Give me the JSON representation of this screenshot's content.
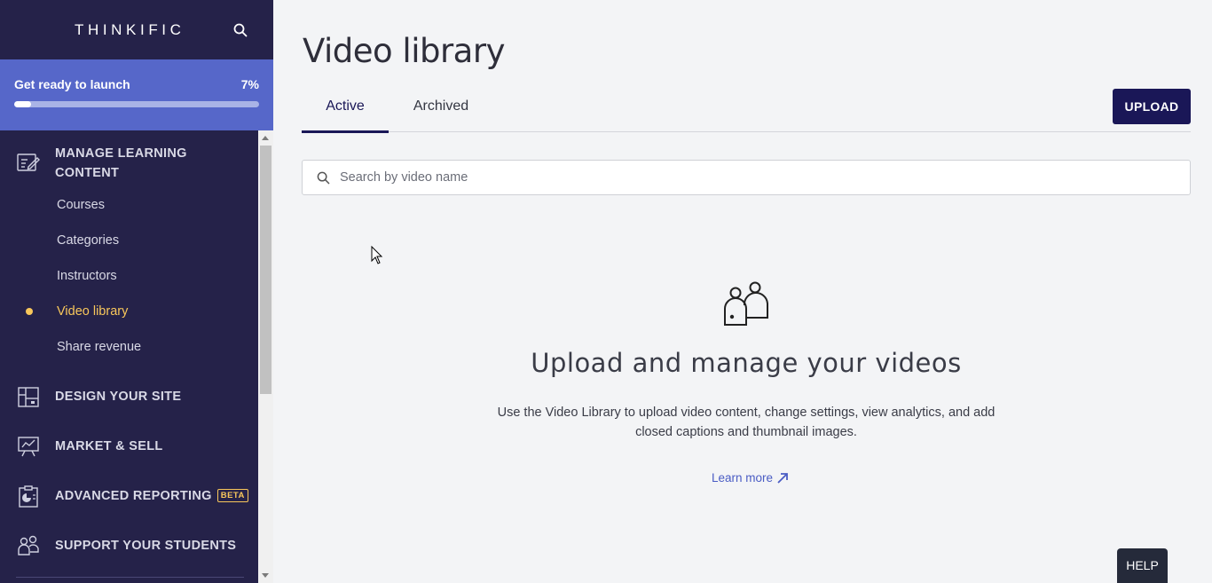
{
  "brand": {
    "name": "THINKIFIC"
  },
  "launch": {
    "title": "Get ready to launch",
    "percent_label": "7%",
    "progress": 0.07
  },
  "nav": {
    "manage_learning": {
      "label_line1": "MANAGE LEARNING",
      "label_line2": "CONTENT",
      "items": [
        {
          "label": "Courses"
        },
        {
          "label": "Categories"
        },
        {
          "label": "Instructors"
        },
        {
          "label": "Video library"
        },
        {
          "label": "Share revenue"
        }
      ]
    },
    "design_site": {
      "label": "DESIGN YOUR SITE"
    },
    "market_sell": {
      "label": "MARKET & SELL"
    },
    "advanced_reporting": {
      "label": "ADVANCED REPORTING",
      "badge": "BETA"
    },
    "support_students": {
      "label": "SUPPORT YOUR STUDENTS"
    }
  },
  "main": {
    "title": "Video library",
    "tabs": [
      {
        "label": "Active"
      },
      {
        "label": "Archived"
      }
    ],
    "upload_label": "UPLOAD",
    "search_placeholder": "Search by video name",
    "empty_state": {
      "title": "Upload and manage your videos",
      "description": "Use the Video Library to upload video content, change settings, view analytics, and add closed captions and thumbnail images.",
      "learn_more": "Learn more"
    },
    "help_label": "HELP"
  },
  "colors": {
    "sidebar_bg": "#252249",
    "launch_bg": "#5667c9",
    "accent_navy": "#1a1757",
    "active_yellow": "#f8c75b",
    "link_blue": "#4a5cc4"
  }
}
